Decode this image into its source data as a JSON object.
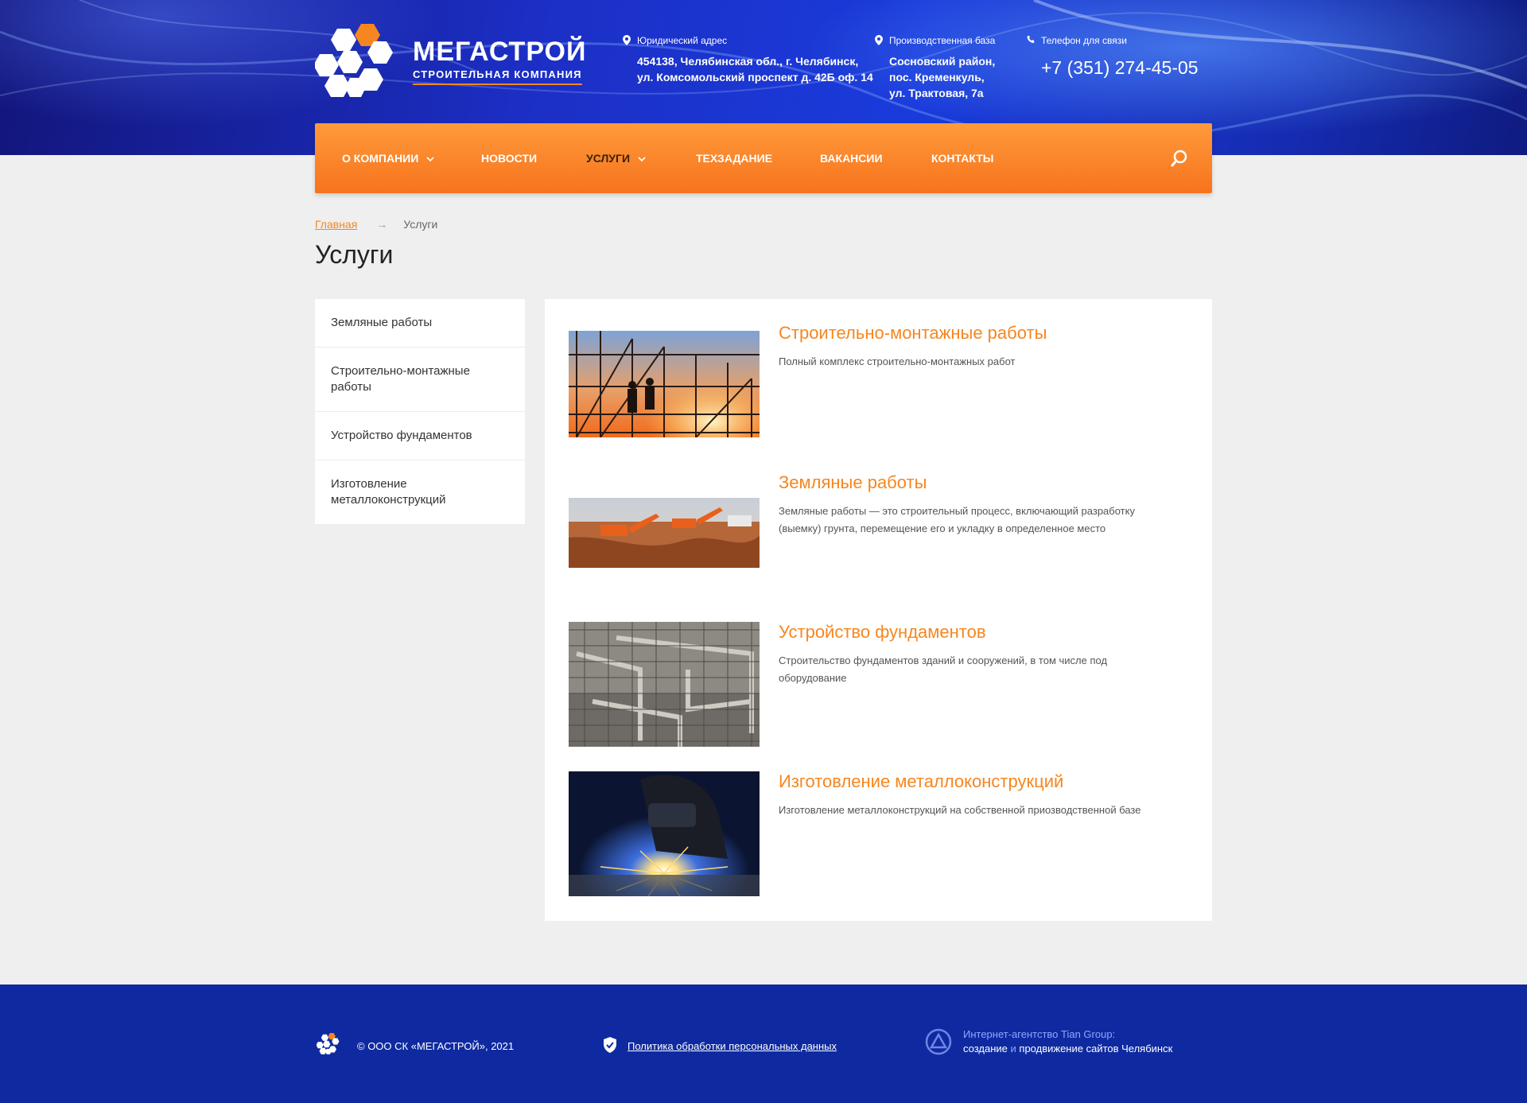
{
  "brand": {
    "name": "МЕГАСТРОЙ",
    "tagline": "СТРОИТЕЛЬНАЯ КОМПАНИЯ",
    "accent": "#f6861f",
    "blue": "#1a3bdb"
  },
  "header": {
    "legal": {
      "label": "Юридический адрес",
      "line1": "454138, Челябинская обл., г. Челябинск,",
      "line2": "ул. Комсомольский проспект д. 42Б оф. 14"
    },
    "production": {
      "label": "Производственная база",
      "line1": "Сосновский район,",
      "line2": "пос. Кременкуль,",
      "line3": "ул. Трактовая, 7а"
    },
    "phone": {
      "label": "Телефон для связи",
      "number": "+7 (351) 274-45-05"
    }
  },
  "nav": {
    "items": [
      {
        "label": "О компании"
      },
      {
        "label": "Новости"
      },
      {
        "label": "Услуги"
      },
      {
        "label": "Техзадание"
      },
      {
        "label": "Вакансии"
      },
      {
        "label": "Контакты"
      }
    ]
  },
  "breadcrumb": {
    "home": "Главная",
    "sep": "→",
    "current": "Услуги"
  },
  "page": {
    "title": "Услуги"
  },
  "sidebar": {
    "items": [
      {
        "label": "Земляные работы"
      },
      {
        "label": "Строительно-монтажные работы"
      },
      {
        "label": "Устройство фундаментов"
      },
      {
        "label": "Изготовление металлоконструкций"
      }
    ]
  },
  "services": [
    {
      "title": "Строительно-монтажные работы",
      "desc": "Полный комплекс строительно-монтажных работ"
    },
    {
      "title": "Земляные работы",
      "desc": "Земляные работы — это строительный процесс, включающий разработку (выемку) грунта, перемещение его и укладку в определенное место"
    },
    {
      "title": "Устройство фундаментов",
      "desc": "Строительство фундаментов зданий и сооружений, в том числе под оборудование"
    },
    {
      "title": "Изготовление металлоконструкций",
      "desc": "Изготовление металлоконструкций на собственной приозводственной базе"
    }
  ],
  "footer": {
    "copyright": "© ООО СК «МЕГАСТРОЙ», 2021",
    "policy": "Политика обработки персональных данных",
    "agency_line1": "Интернет-агентство Tian Group:",
    "agency_create": "создание",
    "agency_and": " и ",
    "agency_rest": "продвижение сайтов Челябинск"
  }
}
